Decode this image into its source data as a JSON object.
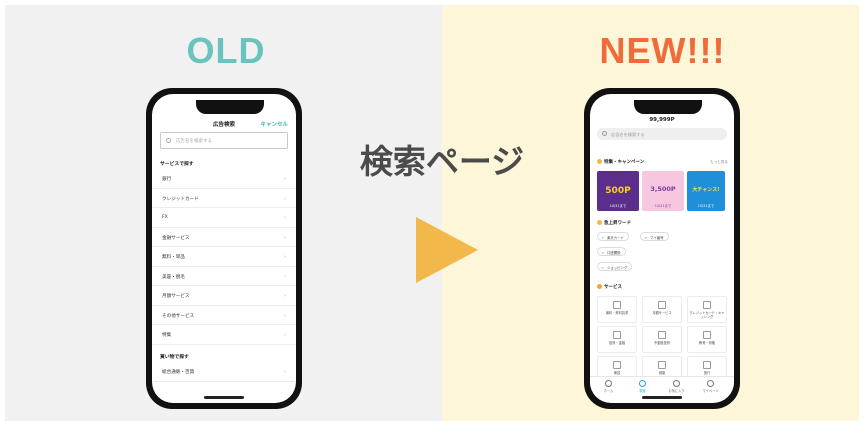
{
  "headings": {
    "old": "OLD",
    "new": "NEW!!!",
    "center": "検索ページ"
  },
  "colors": {
    "old_accent": "#6bc3be",
    "new_accent": "#f06b3a",
    "arrow": "#f2b84b"
  },
  "old_screen": {
    "title": "広告検索",
    "cancel": "キャンセル",
    "search_placeholder": "広告名を検索する",
    "section_services": "サービスで探す",
    "items": [
      "銀行",
      "クレジットカード",
      "FX",
      "金融サービス",
      "無料・単品",
      "美容・脱毛",
      "月額サービス",
      "その他サービス",
      "特集"
    ],
    "section_shopping": "買い物で探す",
    "items2": [
      "総合通販・百貨"
    ]
  },
  "new_screen": {
    "points": "99,999P",
    "search_placeholder": "広告名を検索する",
    "section_features": "特集・キャンペーン",
    "more": "もっと見る",
    "banners": [
      {
        "big": "500P",
        "small": "10/31まで"
      },
      {
        "big": "3,500P",
        "small": "10/31まで"
      },
      {
        "big": "大チャンス!",
        "small": "10/31まで"
      }
    ],
    "section_keywords": "急上昇ワード",
    "keywords": [
      "楽天カード",
      "マイ番号",
      "口座開設",
      "ショッピング"
    ],
    "section_services": "サービス",
    "services": [
      "無料・資料請求",
      "月額サービス",
      "クレジットカード・キャッシング",
      "投資・金融",
      "不動産投資",
      "教育・資格",
      "美容",
      "健康",
      "旅行"
    ],
    "tabs": [
      "ホーム",
      "検索",
      "お気に入り",
      "マイページ"
    ]
  }
}
